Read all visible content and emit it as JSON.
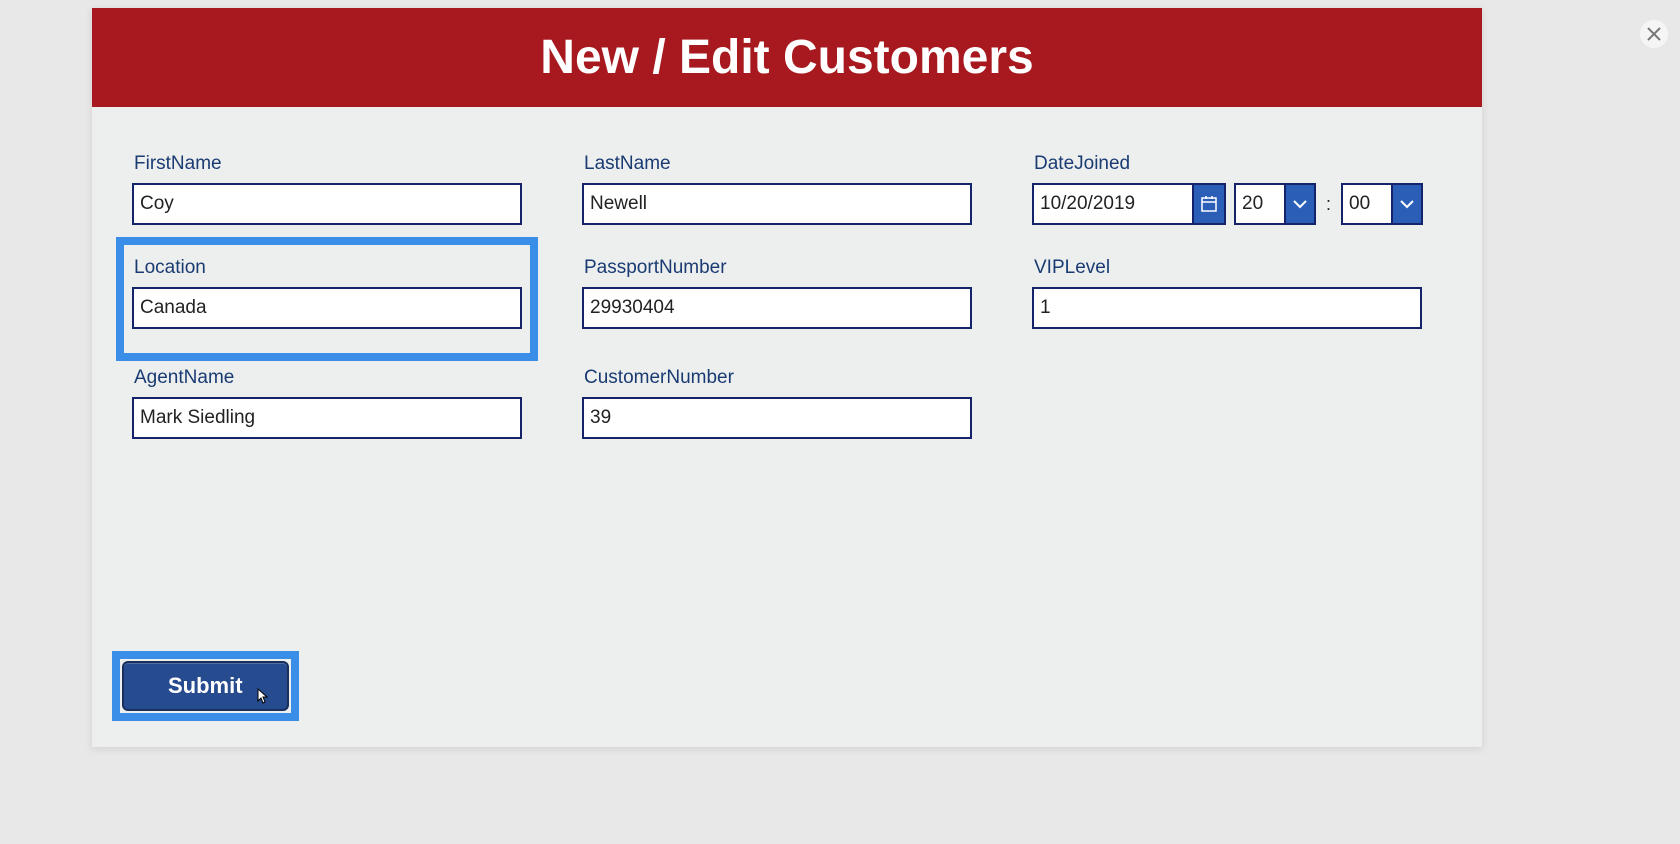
{
  "header": {
    "title": "New / Edit Customers"
  },
  "fields": {
    "firstName": {
      "label": "FirstName",
      "value": "Coy"
    },
    "lastName": {
      "label": "LastName",
      "value": "Newell"
    },
    "dateJoined": {
      "label": "DateJoined",
      "date": "10/20/2019",
      "hour": "20",
      "minute": "00"
    },
    "location": {
      "label": "Location",
      "value": "Canada"
    },
    "passportNumber": {
      "label": "PassportNumber",
      "value": "29930404"
    },
    "vipLevel": {
      "label": "VIPLevel",
      "value": "1"
    },
    "agentName": {
      "label": "AgentName",
      "value": "Mark Siedling"
    },
    "customerNumber": {
      "label": "CustomerNumber",
      "value": "39"
    }
  },
  "buttons": {
    "submit": "Submit"
  },
  "separators": {
    "time": ":"
  }
}
